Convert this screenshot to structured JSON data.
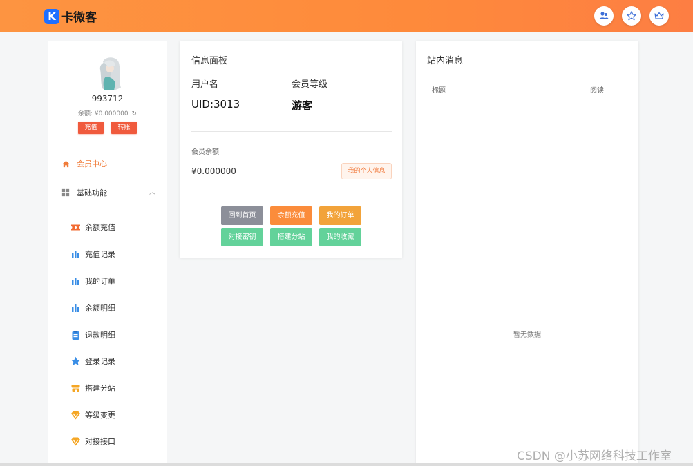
{
  "header": {
    "logo_letter": "K",
    "brand": "卡微客",
    "icons": [
      "users-icon",
      "star-icon",
      "crown-icon"
    ]
  },
  "sidebar": {
    "username": "993712",
    "balance_label": "余额: ¥0.000000",
    "recharge_button": "充值",
    "transfer_button": "转账",
    "nav": [
      {
        "label": "会员中心",
        "icon": "home-icon",
        "active": true
      },
      {
        "label": "基础功能",
        "icon": "grid-icon",
        "expanded": true
      }
    ],
    "sub_items": [
      {
        "label": "余额充值",
        "icon": "ticket-icon",
        "color": "#f26b32"
      },
      {
        "label": "充值记录",
        "icon": "bar-chart-icon",
        "color": "#3a8ee6"
      },
      {
        "label": "我的订单",
        "icon": "bar-chart-icon",
        "color": "#3a8ee6"
      },
      {
        "label": "余额明细",
        "icon": "bar-chart-icon",
        "color": "#3a8ee6"
      },
      {
        "label": "退款明细",
        "icon": "clipboard-icon",
        "color": "#3a8ee6"
      },
      {
        "label": "登录记录",
        "icon": "star-badge-icon",
        "color": "#3a8ee6"
      },
      {
        "label": "搭建分站",
        "icon": "store-icon",
        "color": "#f5a623"
      },
      {
        "label": "等级变更",
        "icon": "diamond-icon",
        "color": "#f5a623"
      },
      {
        "label": "对接接口",
        "icon": "diamond-icon",
        "color": "#f5a623"
      }
    ]
  },
  "info_panel": {
    "title": "信息面板",
    "username_label": "用户名",
    "level_label": "会员等级",
    "uid": "UID:3013",
    "level": "游客",
    "balance_label": "会员余额",
    "balance_value": "¥0.000000",
    "my_info_button": "我的个人信息",
    "actions": [
      {
        "label": "回到首页",
        "color": "#8c8f99"
      },
      {
        "label": "余额充值",
        "color": "#fb8c3b"
      },
      {
        "label": "我的订单",
        "color": "#f2a33a"
      },
      {
        "label": "对接密钥",
        "color": "#63d29a"
      },
      {
        "label": "搭建分站",
        "color": "#63d29a"
      },
      {
        "label": "我的收藏",
        "color": "#63d29a"
      }
    ]
  },
  "messages": {
    "title": "站内消息",
    "col_title": "标题",
    "col_read": "阅读",
    "empty": "暂无数据"
  },
  "watermark": "CSDN @小苏网络科技工作室"
}
